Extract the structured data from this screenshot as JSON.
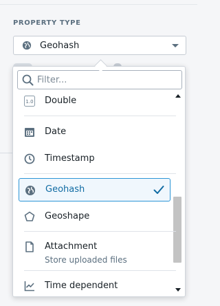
{
  "section_label": "PROPERTY TYPE",
  "select": {
    "value": "Geohash",
    "icon": "globe-icon"
  },
  "filter": {
    "placeholder": "Filter..."
  },
  "items": [
    {
      "label": "Double",
      "icon": "decimal-icon",
      "badge": "1.0"
    },
    {
      "label": "Date",
      "icon": "calendar-icon"
    },
    {
      "label": "Timestamp",
      "icon": "clock-icon"
    },
    {
      "label": "Geohash",
      "icon": "globe-icon",
      "selected": true
    },
    {
      "label": "Geoshape",
      "icon": "polygon-icon"
    },
    {
      "label": "Attachment",
      "icon": "document-icon",
      "description": "Store uploaded files"
    },
    {
      "label": "Time dependent",
      "icon": "timeline-chart-icon"
    }
  ],
  "colors": {
    "accent": "#2b95d6",
    "selected_text": "#106ba3",
    "muted": "#5c7080"
  }
}
